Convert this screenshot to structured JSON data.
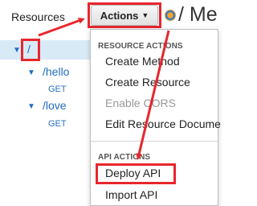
{
  "header": {
    "resources_label": "Resources",
    "actions_label": "Actions",
    "path_title": "/ Me"
  },
  "tree": {
    "root": "/",
    "items": [
      {
        "path": "/hello",
        "method": "GET"
      },
      {
        "path": "/love",
        "method": "GET"
      }
    ]
  },
  "menu": {
    "resource_actions_header": "RESOURCE ACTIONS",
    "resource_items": [
      "Create Method",
      "Create Resource",
      "Enable CORS",
      "Edit Resource Docume"
    ],
    "api_actions_header": "API ACTIONS",
    "api_items": [
      "Deploy API",
      "Import API"
    ]
  },
  "colors": {
    "highlight": "#e8262d",
    "link": "#1f6cc2",
    "selected_row": "#d9eaf7"
  }
}
